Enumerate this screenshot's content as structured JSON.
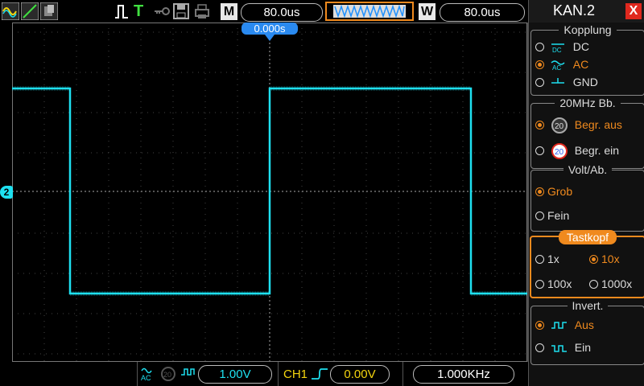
{
  "topbar": {
    "timebase": "80.0us",
    "window_timebase": "80.0us",
    "menu_letter": "M",
    "window_letter": "W",
    "trigger_letter": "T"
  },
  "screen": {
    "trigger_position": "0.000s",
    "channel_marker": "2"
  },
  "bottombar": {
    "ch_volts": "1.00V",
    "trigger_source": "CH1",
    "trigger_level": "0.00V",
    "frequency": "1.000KHz"
  },
  "panel": {
    "title": "KAN.2",
    "close_label": "X",
    "coupling": {
      "title": "Kopplung",
      "options": [
        "DC",
        "AC",
        "GND"
      ],
      "selected": "AC"
    },
    "bandwidth": {
      "title": "20MHz  Bb.",
      "options": [
        "Begr.  aus",
        "Begr.  ein"
      ],
      "selected": "Begr.  aus"
    },
    "volt_div": {
      "title": "Volt/Ab.",
      "options": [
        "Grob",
        "Fein"
      ],
      "selected": "Grob"
    },
    "probe": {
      "title": "Tastkopf",
      "options": [
        "1x",
        "10x",
        "100x",
        "1000x"
      ],
      "selected": "10x"
    },
    "invert": {
      "title": "Invert.",
      "options": [
        "Aus",
        "Ein"
      ],
      "selected": "Aus"
    }
  },
  "colors": {
    "trace": "#1ee0f0",
    "accent": "#f08a1e",
    "trigger_marker": "#2aa0ff"
  }
}
